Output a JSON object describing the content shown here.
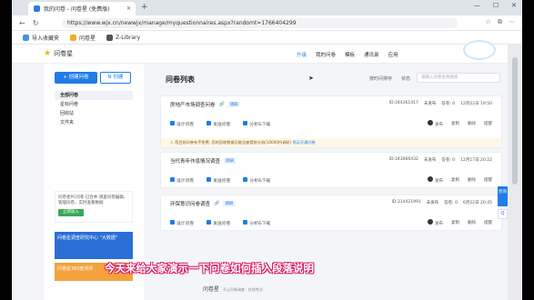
{
  "browser": {
    "tab_title": "我的问卷 - 问卷星 (免费版)",
    "url": "https://www.wjx.cn/newwjx/manage/myquestionnaires.aspx?randomt=1766404299",
    "bookmarks": [
      "导入收藏夹",
      "问卷星",
      "Z-Library"
    ]
  },
  "header": {
    "logo": "问卷星",
    "nav": [
      "升级",
      "我的问卷",
      "模板",
      "通讯录",
      "应用"
    ]
  },
  "sidebar": {
    "create": "创建问卷",
    "create2": "创建",
    "items": [
      "全部问卷",
      "星标问卷",
      "回收站",
      "文件夹"
    ],
    "promo1_text": "问卷星PC问卷 已合并 调查问卷编辑，管理问卷，实时查看数据",
    "promo1_btn": "立即加入",
    "promo2": "问卷星调查研究中心 \"大数据\"",
    "promo3": "问卷星360度测评"
  },
  "main": {
    "title": "问卷列表",
    "filter1": "按时间排序",
    "filter2": "状态",
    "search_placeholder": "请输入问卷名称搜索",
    "cards": [
      {
        "name": "房地产市场调查问卷",
        "tag": "调研",
        "id": "ID:344361417",
        "status": "未发布",
        "answers": "答卷: 0",
        "date": "12月22日 19:50",
        "warn": "您目前问卷有不免费, 您的回收数据可能会被提前分流(10000份调研)",
        "warn_link": "购买开通问卷"
      },
      {
        "name": "当代青年作息情况调查",
        "tag": "调研",
        "id": "ID:343666432",
        "status": "未发布",
        "answers": "答卷: 0",
        "date": "12月17日 20:22"
      },
      {
        "name": "环保意识问卷调查",
        "tag": "调研",
        "id": "ID:314421991",
        "status": "未发布",
        "answers": "答卷: 0",
        "date": "6月22日 20:45"
      }
    ],
    "actions": [
      "设计问卷",
      "发送问卷",
      "分析&下载"
    ],
    "card_acts": [
      "发布",
      "复制",
      "删除",
      "提醒"
    ]
  },
  "footer": {
    "brand": "问卷星",
    "slogan": "不止问卷调查 · 在线考试"
  },
  "float": {
    "label": "咨询",
    "qa": "Q"
  },
  "subtitle": "今天来给大家演示一下问卷如何插入段落说明"
}
